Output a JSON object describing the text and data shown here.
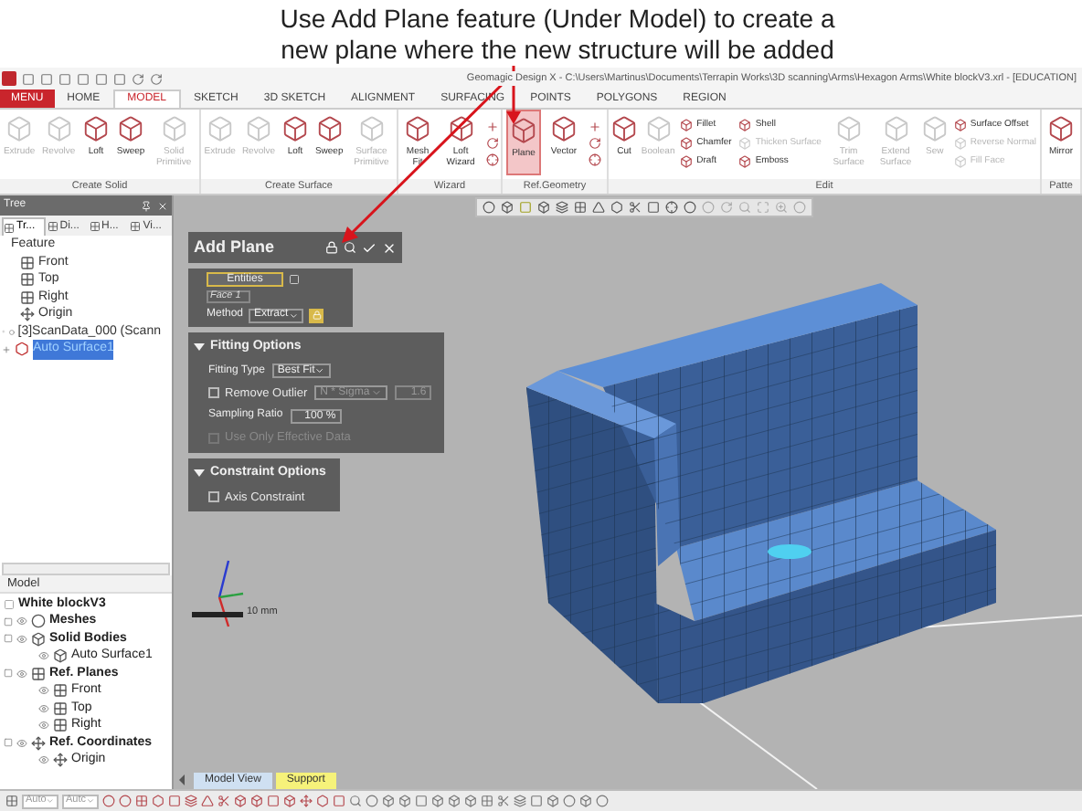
{
  "caption": [
    "Use Add Plane feature (Under Model) to create a",
    "new plane where the new structure will be added"
  ],
  "window": {
    "title": "Geomagic Design X - C:\\Users\\Martinus\\Documents\\Terrapin Works\\3D scanning\\Arms\\Hexagon Arms\\White blockV3.xrl - [EDUCATION]"
  },
  "menu_button": "MENU",
  "tabs": [
    {
      "label": "HOME",
      "selected": false
    },
    {
      "label": "MODEL",
      "selected": true
    },
    {
      "label": "SKETCH",
      "selected": false
    },
    {
      "label": "3D SKETCH",
      "selected": false
    },
    {
      "label": "ALIGNMENT",
      "selected": false
    },
    {
      "label": "SURFACING",
      "selected": false
    },
    {
      "label": "POINTS",
      "selected": false
    },
    {
      "label": "POLYGONS",
      "selected": false
    },
    {
      "label": "REGION",
      "selected": false
    }
  ],
  "ribbon": [
    {
      "label": "Create Solid",
      "items": [
        {
          "kind": "large",
          "label": "Extrude",
          "disabled": true,
          "selected": false
        },
        {
          "kind": "large",
          "label": "Revolve",
          "disabled": true,
          "selected": false
        },
        {
          "kind": "large",
          "label": "Loft",
          "disabled": false,
          "selected": false
        },
        {
          "kind": "large",
          "label": "Sweep",
          "disabled": false,
          "selected": false
        },
        {
          "kind": "large",
          "label": "Solid Primitive",
          "disabled": true,
          "selected": false
        }
      ]
    },
    {
      "label": "Create Surface",
      "items": [
        {
          "kind": "large",
          "label": "Extrude",
          "disabled": true,
          "selected": false
        },
        {
          "kind": "large",
          "label": "Revolve",
          "disabled": true,
          "selected": false
        },
        {
          "kind": "large",
          "label": "Loft",
          "disabled": false,
          "selected": false
        },
        {
          "kind": "large",
          "label": "Sweep",
          "disabled": false,
          "selected": false
        },
        {
          "kind": "large",
          "label": "Surface Primitive",
          "disabled": true,
          "selected": false
        }
      ]
    },
    {
      "label": "Wizard",
      "items": [
        {
          "kind": "large",
          "label": "Mesh Fit",
          "disabled": false,
          "selected": false
        },
        {
          "kind": "large",
          "label": "Loft Wizard",
          "disabled": false,
          "selected": false
        },
        {
          "kind": "icons"
        }
      ]
    },
    {
      "label": "Ref.Geometry",
      "items": [
        {
          "kind": "large",
          "label": "Plane",
          "disabled": false,
          "selected": true
        },
        {
          "kind": "large",
          "label": "Vector",
          "disabled": false,
          "selected": false
        },
        {
          "kind": "icons"
        }
      ]
    },
    {
      "label": "Edit",
      "items": [
        {
          "kind": "large",
          "label": "Cut",
          "disabled": false,
          "selected": false
        },
        {
          "kind": "large",
          "label": "Boolean",
          "disabled": true,
          "selected": false
        },
        {
          "kind": "stack",
          "entries": [
            {
              "label": "Fillet",
              "disabled": false
            },
            {
              "label": "Chamfer",
              "disabled": false
            },
            {
              "label": "Draft",
              "disabled": false
            }
          ]
        },
        {
          "kind": "stack",
          "entries": [
            {
              "label": "Shell",
              "disabled": false
            },
            {
              "label": "Thicken Surface",
              "disabled": true
            },
            {
              "label": "Emboss",
              "disabled": false
            }
          ]
        },
        {
          "kind": "large",
          "label": "Trim Surface",
          "disabled": true,
          "selected": false
        },
        {
          "kind": "large",
          "label": "Extend Surface",
          "disabled": true,
          "selected": false
        },
        {
          "kind": "large",
          "label": "Sew",
          "disabled": true,
          "selected": false
        },
        {
          "kind": "stack",
          "entries": [
            {
              "label": "Surface Offset",
              "disabled": false
            },
            {
              "label": "Reverse Normal",
              "disabled": true
            },
            {
              "label": "Fill Face",
              "disabled": true
            }
          ]
        }
      ]
    },
    {
      "label": "Patte",
      "items": [
        {
          "kind": "large",
          "label": "Mirror",
          "disabled": false,
          "selected": false
        }
      ]
    }
  ],
  "tree_panel": {
    "title": "Tree",
    "tabs": [
      {
        "label": "Tr...",
        "selected": true
      },
      {
        "label": "Di...",
        "selected": false
      },
      {
        "label": "H...",
        "selected": false
      },
      {
        "label": "Vi...",
        "selected": false
      }
    ],
    "feature_header": "Feature",
    "features": [
      {
        "kind": "plane",
        "label": "Front",
        "selected": false
      },
      {
        "kind": "plane",
        "label": "Top",
        "selected": false
      },
      {
        "kind": "plane",
        "label": "Right",
        "selected": false
      },
      {
        "kind": "origin",
        "label": "Origin",
        "selected": false
      },
      {
        "kind": "mesh",
        "label": "[3]ScanData_000 (Scann",
        "selected": false
      },
      {
        "kind": "surface",
        "label": "Auto Surface1",
        "selected": true
      }
    ],
    "model_header": "Model",
    "model_root": "White blockV3",
    "model_tree": [
      {
        "kind": "mesh",
        "label": "Meshes"
      },
      {
        "kind": "body",
        "label": "Solid Bodies",
        "children": [
          {
            "kind": "body",
            "label": "Auto Surface1"
          }
        ]
      },
      {
        "kind": "plane",
        "label": "Ref. Planes",
        "children": [
          {
            "kind": "plane",
            "label": "Front"
          },
          {
            "kind": "plane",
            "label": "Top"
          },
          {
            "kind": "plane",
            "label": "Right"
          }
        ]
      },
      {
        "kind": "origin",
        "label": "Ref. Coordinates",
        "children": [
          {
            "kind": "origin",
            "label": "Origin"
          }
        ]
      }
    ]
  },
  "dialog": {
    "title": "Add Plane",
    "entities": {
      "button": "Entities",
      "face": "Face 1",
      "method_label": "Method",
      "method": "Extract"
    },
    "fitting": {
      "title": "Fitting Options",
      "type_label": "Fitting Type",
      "type": "Best Fit",
      "remove_outlier": {
        "label": "Remove Outlier",
        "checked": false
      },
      "sigma": "N * Sigma",
      "sigma_value": "1.6",
      "sampling_label": "Sampling Ratio",
      "sampling": "100 %",
      "effective": {
        "label": "Use Only Effective Data",
        "checked": false,
        "disabled": true
      }
    },
    "constraint": {
      "title": "Constraint Options",
      "axis": {
        "label": "Axis Constraint",
        "checked": false
      }
    }
  },
  "scale_label": "10 mm",
  "view_tabs": [
    {
      "label": "Model View",
      "color": "#cfe0f2"
    },
    {
      "label": "Support",
      "color": "#f6f27a"
    }
  ],
  "bottom_toolbar": {
    "dropdowns": [
      "Auto",
      "Autc"
    ]
  }
}
